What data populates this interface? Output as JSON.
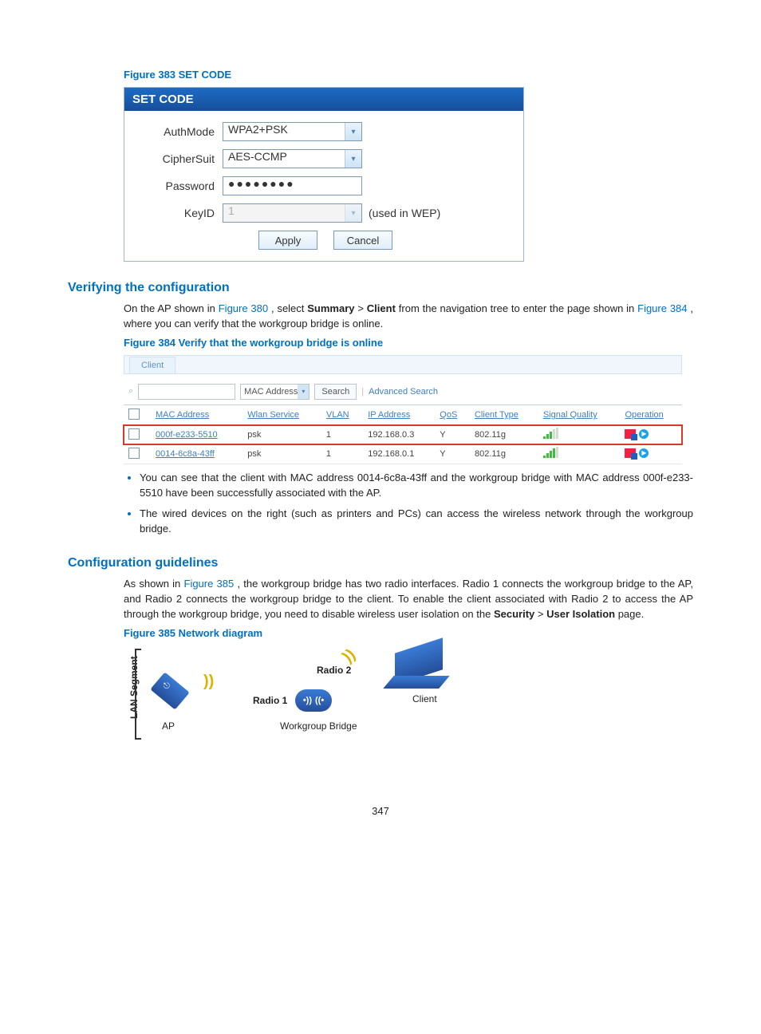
{
  "fig383": {
    "caption": "Figure 383 SET CODE",
    "header": "SET CODE",
    "rows": {
      "authmode": {
        "label": "AuthMode",
        "value": "WPA2+PSK"
      },
      "ciphersuit": {
        "label": "CipherSuit",
        "value": "AES-CCMP"
      },
      "password": {
        "label": "Password",
        "value": "●●●●●●●●"
      },
      "keyid": {
        "label": "KeyID",
        "value": "1",
        "note": "(used in WEP)"
      }
    },
    "buttons": {
      "apply": "Apply",
      "cancel": "Cancel"
    }
  },
  "sec_verify": {
    "heading": "Verifying the configuration",
    "p1_a": "On the AP shown in ",
    "p1_link1": "Figure 380",
    "p1_b": ", select ",
    "p1_bold1": "Summary",
    "p1_gt": " > ",
    "p1_bold2": "Client",
    "p1_c": " from the navigation tree to enter the page shown in ",
    "p1_link2": "Figure 384",
    "p1_d": ", where you can verify that the workgroup bridge is online."
  },
  "fig384": {
    "caption": "Figure 384 Verify that the workgroup bridge is online",
    "tab": "Client",
    "search_field": "MAC Address",
    "search_btn": "Search",
    "adv": "Advanced Search",
    "cols": [
      "MAC Address",
      "Wlan Service",
      "VLAN",
      "IP Address",
      "QoS",
      "Client Type",
      "Signal Quality",
      "Operation"
    ],
    "rows": [
      {
        "mac": "000f-e233-5510",
        "svc": "psk",
        "vlan": "1",
        "ip": "192.168.0.3",
        "qos": "Y",
        "type": "802.11g"
      },
      {
        "mac": "0014-6c8a-43ff",
        "svc": "psk",
        "vlan": "1",
        "ip": "192.168.0.1",
        "qos": "Y",
        "type": "802.11g"
      }
    ]
  },
  "bullets": {
    "b1": "You can see that the client with MAC address 0014-6c8a-43ff and the workgroup bridge with MAC address 000f-e233-5510 have been successfully associated with the AP.",
    "b2": "The wired devices on the right (such as printers and PCs) can access the wireless network through the workgroup bridge."
  },
  "sec_cfg": {
    "heading": "Configuration guidelines",
    "p_a": "As shown in ",
    "p_link": "Figure 385",
    "p_b": ", the workgroup bridge has two radio interfaces. Radio 1 connects the workgroup bridge to the AP, and Radio 2 connects the workgroup bridge to the client. To enable the client associated with Radio 2 to access the AP through the workgroup bridge, you need to disable wireless user isolation on the ",
    "p_bold1": "Security",
    "p_gt": " > ",
    "p_bold2": "User Isolation",
    "p_c": " page."
  },
  "fig385": {
    "caption": "Figure 385 Network diagram",
    "lan": "LAN Segment",
    "ap": "AP",
    "radio1": "Radio 1",
    "radio2": "Radio 2",
    "bridge": "Workgroup Bridge",
    "client": "Client"
  },
  "page": "347"
}
